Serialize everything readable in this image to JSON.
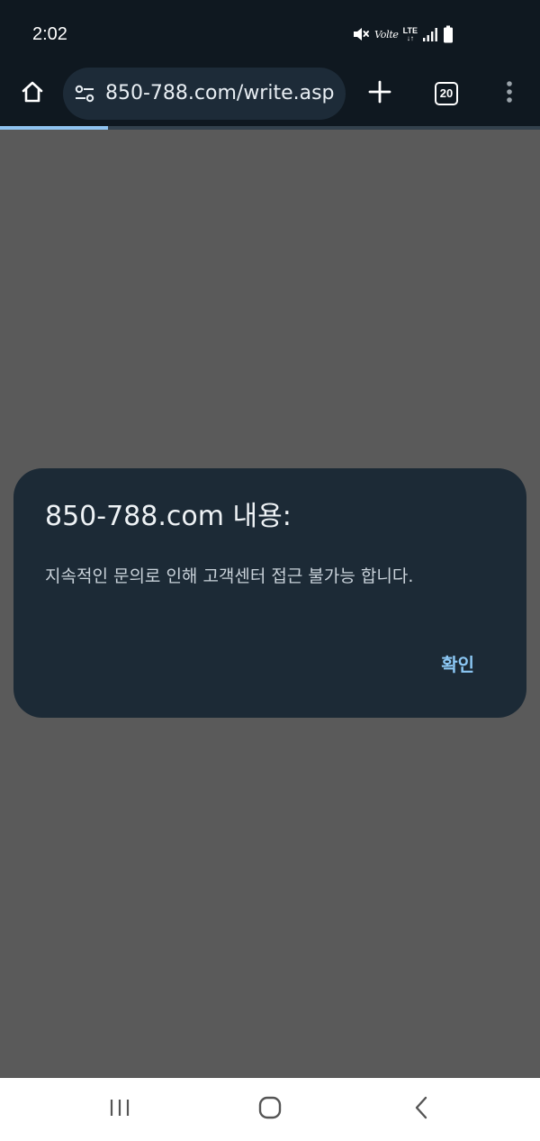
{
  "status_bar": {
    "time": "2:02",
    "volte": "Volte",
    "lte": "LTE",
    "lte_arrows": "↓↑",
    "icons": [
      "mute-icon",
      "volte-icon",
      "lte-icon",
      "signal-icon",
      "battery-icon"
    ]
  },
  "toolbar": {
    "url": "850-788.com/write.asp",
    "tab_count": "20",
    "icons": [
      "home-icon",
      "site-settings-icon",
      "plus-icon",
      "tab-switcher-icon",
      "more-vert-icon"
    ],
    "load_progress": 0.2
  },
  "dialog": {
    "title": "850-788.com 내용:",
    "message": "지속적인 문의로 인해 고객센터 접근 불가능 합니다.",
    "ok_label": "확인"
  },
  "nav_bar": {
    "icons": [
      "recents-icon",
      "home-circle-icon",
      "back-chevron-icon"
    ]
  },
  "colors": {
    "chrome_background": "#0f1820",
    "url_box": "#1d2b38",
    "scrim": "#5a5a5a",
    "dialog_background": "#1c2a36",
    "accent": "#8cc8f5",
    "progress": "#8fc3f0"
  }
}
